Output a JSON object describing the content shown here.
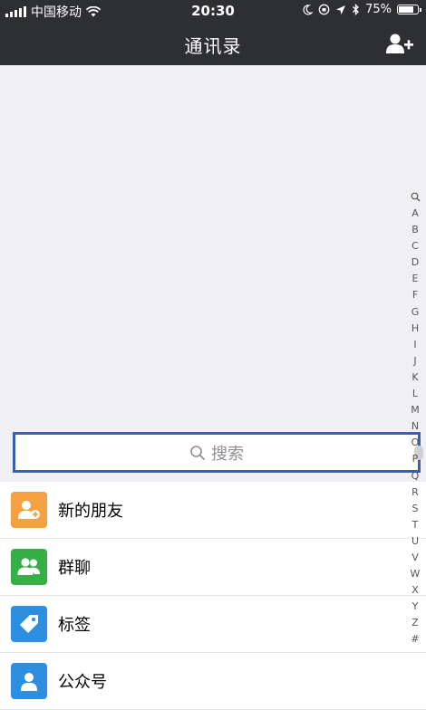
{
  "status_bar": {
    "carrier": "中国移动",
    "time": "20:30",
    "battery_text": "75%",
    "battery_level": 0.75
  },
  "nav": {
    "title": "通讯录",
    "add_icon": "add-contact-icon"
  },
  "search": {
    "placeholder": "搜索",
    "icon": "search-icon"
  },
  "list": {
    "items": [
      {
        "label": "新的朋友",
        "icon": "new-friends-icon",
        "color": "#f5a041"
      },
      {
        "label": "群聊",
        "icon": "group-chat-icon",
        "color": "#35b047"
      },
      {
        "label": "标签",
        "icon": "tag-icon",
        "color": "#2d8ee0"
      },
      {
        "label": "公众号",
        "icon": "official-accounts-icon",
        "color": "#2d8ee0"
      }
    ]
  },
  "index_bar": [
    "A",
    "B",
    "C",
    "D",
    "E",
    "F",
    "G",
    "H",
    "I",
    "J",
    "K",
    "L",
    "M",
    "N",
    "O",
    "P",
    "Q",
    "R",
    "S",
    "T",
    "U",
    "V",
    "W",
    "X",
    "Y",
    "Z",
    "#"
  ]
}
